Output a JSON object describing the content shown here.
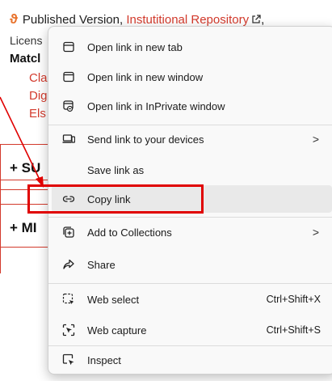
{
  "background": {
    "oa_symbol": "ϑ",
    "published_prefix": "Published Version, ",
    "repository_link": "Instutitional Repository",
    "trailing_comma": ",",
    "license_text": "Licens",
    "match_heading": "Matcl",
    "items": [
      "Cla",
      "Dig",
      "Els"
    ],
    "sections": [
      "+ SU",
      "+ MI"
    ]
  },
  "menu": {
    "items": [
      {
        "label": "Open link in new tab",
        "icon": "new-tab-icon"
      },
      {
        "label": "Open link in new window",
        "icon": "new-window-icon"
      },
      {
        "label": "Open link in InPrivate window",
        "icon": "inprivate-window-icon"
      },
      {
        "label": "Send link to your devices",
        "icon": "send-to-devices-icon",
        "submenu": ">"
      },
      {
        "label": "Save link as"
      },
      {
        "label": "Copy link",
        "icon": "copy-link-icon",
        "highlighted": true
      },
      {
        "label": "Add to Collections",
        "icon": "collections-icon",
        "submenu": ">"
      },
      {
        "label": "Share",
        "icon": "share-icon"
      },
      {
        "label": "Web select",
        "icon": "web-select-icon",
        "shortcut": "Ctrl+Shift+X"
      },
      {
        "label": "Web capture",
        "icon": "web-capture-icon",
        "shortcut": "Ctrl+Shift+S"
      },
      {
        "label": "Inspect",
        "icon": "inspect-icon"
      }
    ]
  },
  "colors": {
    "annotation_red": "#e00000",
    "link_red": "#d33a2c",
    "oa_orange": "#e8712a"
  }
}
